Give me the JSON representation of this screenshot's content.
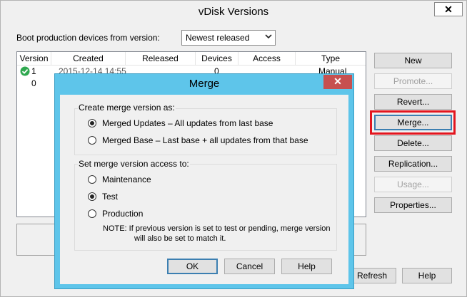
{
  "window": {
    "title": "vDisk Versions",
    "close_glyph": "✕"
  },
  "boot": {
    "label": "Boot production devices from version:",
    "selected": "Newest released"
  },
  "table": {
    "columns": [
      "Version",
      "Created",
      "Released",
      "Devices",
      "Access",
      "Type"
    ],
    "rows": [
      {
        "version": "1",
        "created": "2015-12-14 14:55",
        "released": "",
        "devices": "0",
        "access": "",
        "type": "Manual",
        "status_icon": "check-icon"
      },
      {
        "version": "0",
        "created": "",
        "released": "",
        "devices": "",
        "access": "",
        "type": ""
      }
    ]
  },
  "buttons": {
    "new": "New",
    "promote": "Promote...",
    "revert": "Revert...",
    "merge": "Merge...",
    "delete": "Delete...",
    "replication": "Replication...",
    "usage": "Usage...",
    "properties": "Properties...",
    "refresh": "Refresh",
    "help": "Help"
  },
  "dialog": {
    "title": "Merge",
    "close_glyph": "✕",
    "group1": {
      "label": "Create merge version as:",
      "options": [
        {
          "label": "Merged Updates – All updates from last base",
          "checked": true
        },
        {
          "label": "Merged Base – Last base + all updates from that base",
          "checked": false
        }
      ]
    },
    "group2": {
      "label": "Set merge version access to:",
      "options": [
        {
          "label": "Maintenance",
          "checked": false
        },
        {
          "label": "Test",
          "checked": true
        },
        {
          "label": "Production",
          "checked": false
        }
      ],
      "note_line1": "NOTE:  If previous version is set to test or pending, merge version",
      "note_line2": "will also be set to match it."
    },
    "ok": "OK",
    "cancel": "Cancel",
    "help": "Help"
  },
  "colors": {
    "dialog_frame": "#5ec5ea",
    "highlight": "#e3151e",
    "status_ok": "#2fa84f"
  }
}
